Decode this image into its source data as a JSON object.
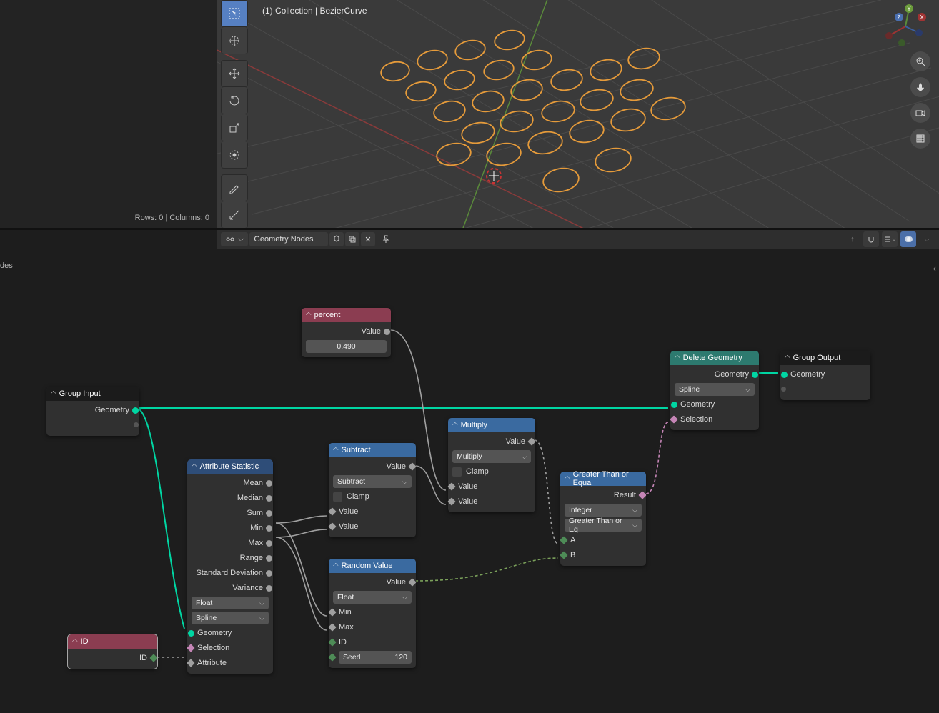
{
  "left_panel": {
    "footer": "Rows: 0   |   Columns: 0"
  },
  "viewport": {
    "breadcrumb": "(1) Collection | BezierCurve"
  },
  "axes": {
    "x": "X",
    "y": "Y",
    "z": "Z"
  },
  "node_header": {
    "title": "Geometry Nodes"
  },
  "crumb_partial": "des",
  "nodes": {
    "group_input": {
      "title": "Group Input",
      "out0": "Geometry"
    },
    "id": {
      "title": "ID",
      "out0": "ID"
    },
    "attr_stat": {
      "title": "Attribute Statistic",
      "outs": [
        "Mean",
        "Median",
        "Sum",
        "Min",
        "Max",
        "Range",
        "Standard Deviation",
        "Variance"
      ],
      "dd0": "Float",
      "dd1": "Spline",
      "in0": "Geometry",
      "in1": "Selection",
      "in2": "Attribute"
    },
    "percent": {
      "title": "percent",
      "out0": "Value",
      "val": "0.490"
    },
    "subtract": {
      "title": "Subtract",
      "out0": "Value",
      "dd": "Subtract",
      "clamp": "Clamp",
      "in0": "Value",
      "in1": "Value"
    },
    "random": {
      "title": "Random Value",
      "out0": "Value",
      "dd": "Float",
      "in0": "Min",
      "in1": "Max",
      "in2": "ID",
      "seed_lbl": "Seed",
      "seed_val": "120"
    },
    "multiply": {
      "title": "Multiply",
      "out0": "Value",
      "dd": "Multiply",
      "clamp": "Clamp",
      "in0": "Value",
      "in1": "Value"
    },
    "gte": {
      "title": "Greater Than or Equal",
      "out0": "Result",
      "dd0": "Integer",
      "dd1": "Greater Than or Eq",
      "in0": "A",
      "in1": "B"
    },
    "delete": {
      "title": "Delete Geometry",
      "out0": "Geometry",
      "dd": "Spline",
      "in0": "Geometry",
      "in1": "Selection"
    },
    "group_output": {
      "title": "Group Output",
      "in0": "Geometry"
    }
  }
}
